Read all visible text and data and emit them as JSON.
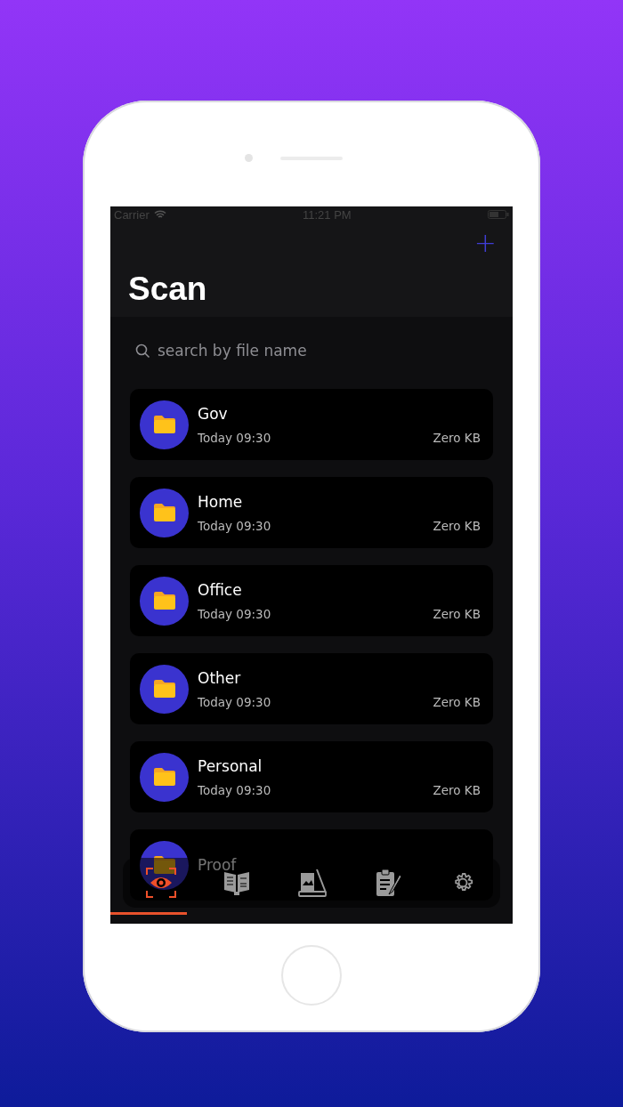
{
  "status_bar": {
    "carrier": "Carrier",
    "time": "11:21 PM"
  },
  "header": {
    "title": "Scan",
    "add_button": "+"
  },
  "search": {
    "placeholder": "search by file name"
  },
  "folders": [
    {
      "name": "Gov",
      "date": "Today 09:30",
      "size": "Zero KB"
    },
    {
      "name": "Home",
      "date": "Today 09:30",
      "size": "Zero KB"
    },
    {
      "name": "Office",
      "date": "Today 09:30",
      "size": "Zero KB"
    },
    {
      "name": "Other",
      "date": "Today 09:30",
      "size": "Zero KB"
    },
    {
      "name": "Personal",
      "date": "Today 09:30",
      "size": "Zero KB"
    },
    {
      "name": "Proof"
    }
  ],
  "tab_bar": [
    {
      "kind": "scan",
      "selected": true
    },
    {
      "kind": "pdf",
      "selected": false
    },
    {
      "kind": "scanner",
      "selected": false
    },
    {
      "kind": "notes",
      "selected": false
    },
    {
      "kind": "settings",
      "selected": false
    }
  ]
}
